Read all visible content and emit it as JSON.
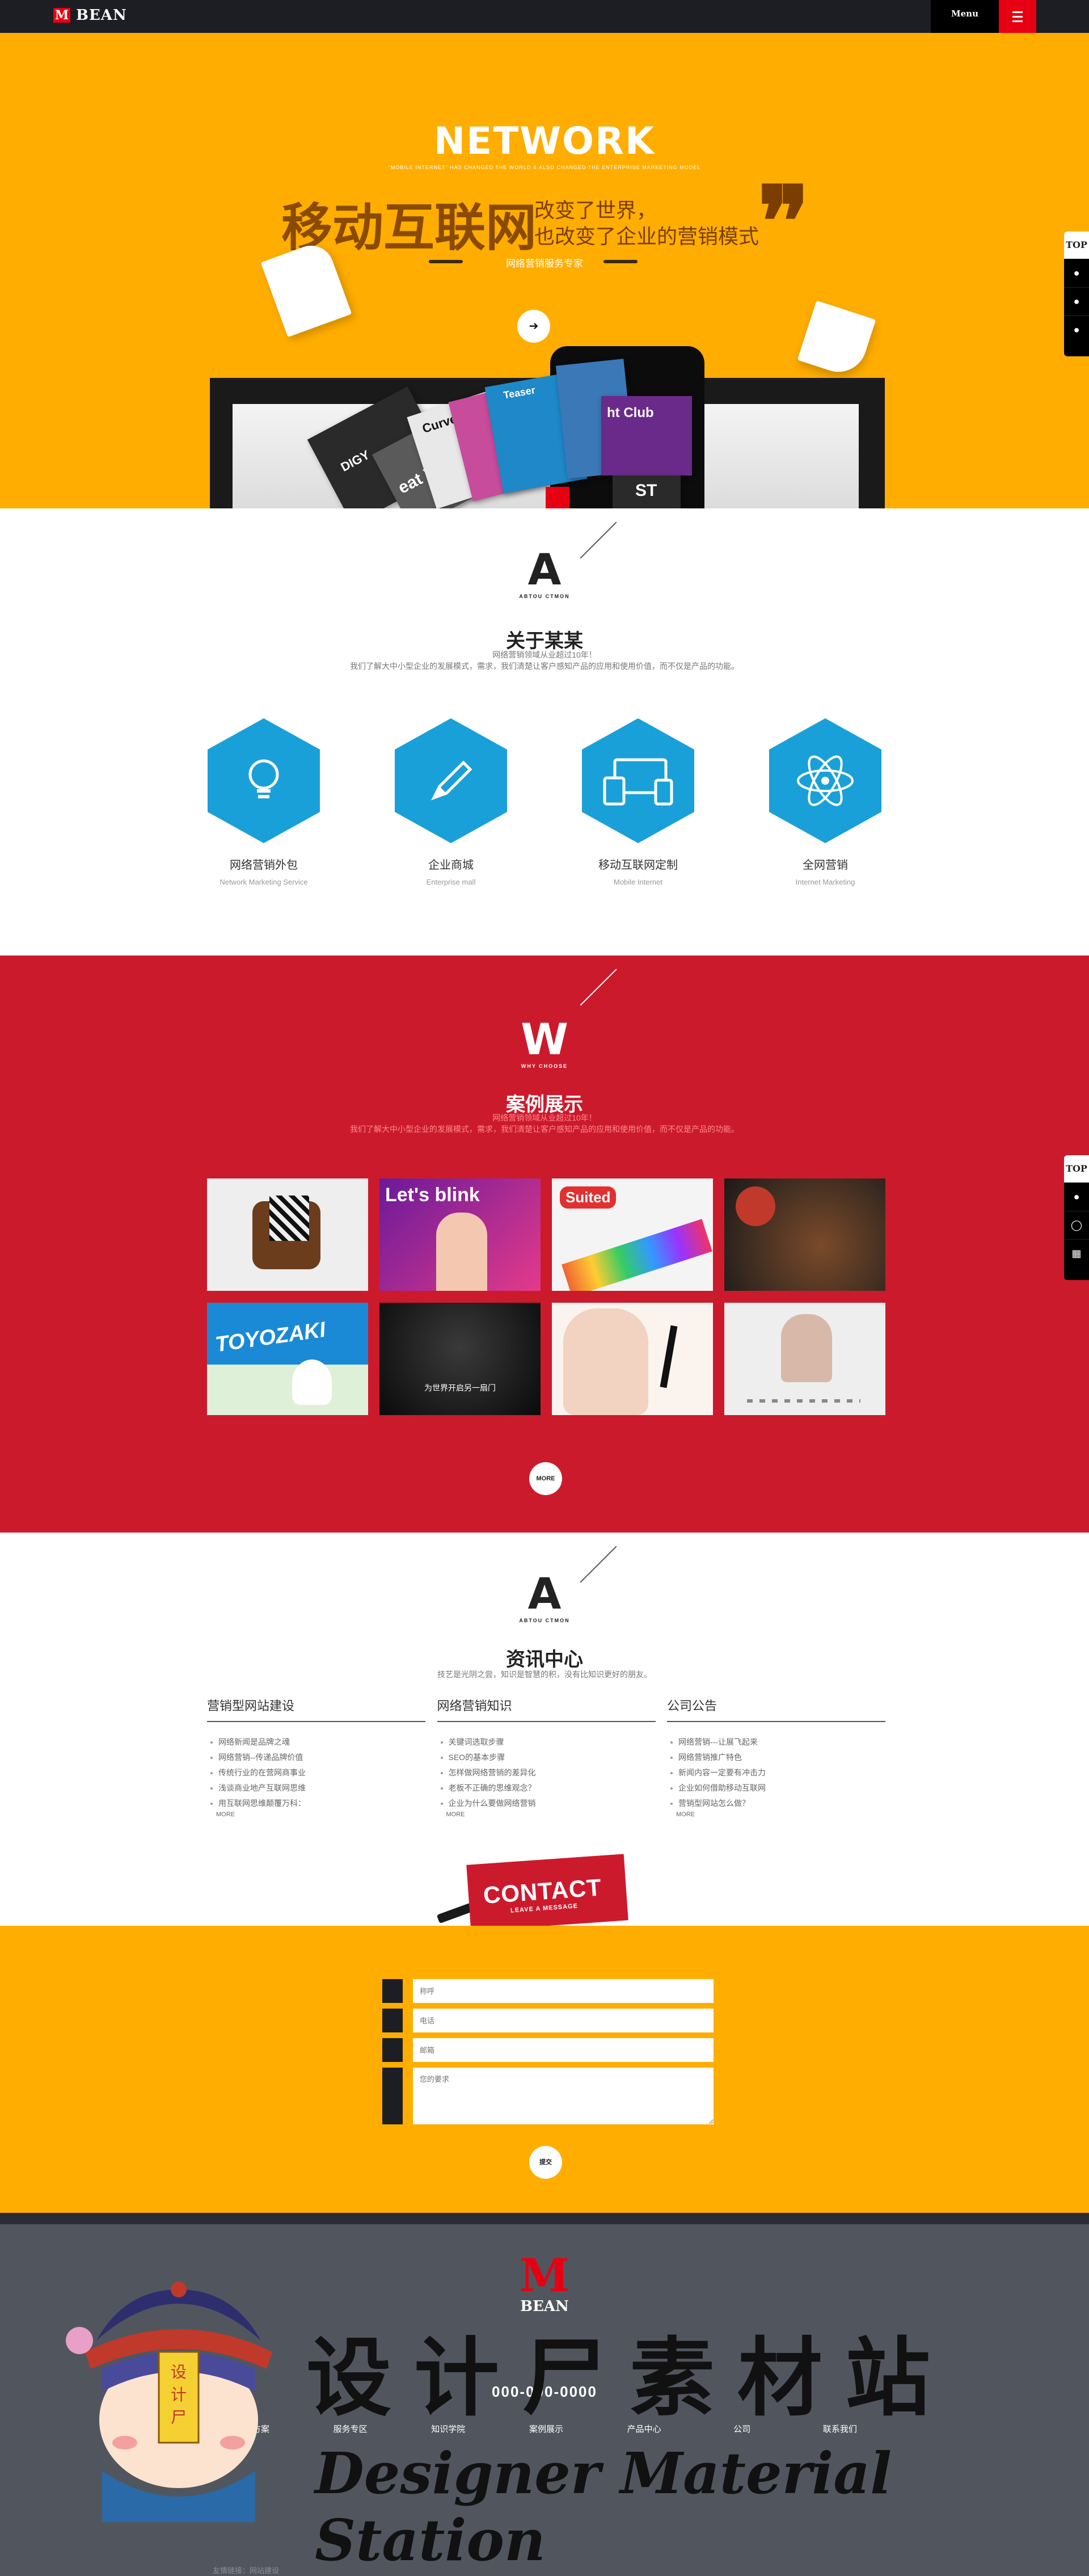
{
  "topbar": {
    "brand_mark": "M",
    "brand": "BEAN",
    "menu_label": "Menu"
  },
  "hero": {
    "title_en": "NETWORK",
    "subtitle_en": "\"MOBILE INTERNET\" HAS CHANGED THE WORLD & ALSO CHANGED THE ENTERPRISE MARKETING MODEL",
    "headline": "移动互联网",
    "line1": "改变了世界，",
    "line2": "也改变了企业的营销模式",
    "tag": "网络营销服务专家",
    "quote": "❞",
    "arrow": "➔",
    "card_labels": [
      "DIGY",
      "Curve",
      "Teaser",
      "ht Club",
      "ST",
      "eat Vision"
    ]
  },
  "side_widget": {
    "top": "TOP"
  },
  "about": {
    "mark_letter": "A",
    "mark_sub": "ABTOU CTMON",
    "title": "关于某某",
    "line1": "网络营销领域从业超过10年！",
    "line2": "我们了解大中小型企业的发展模式，需求，我们清楚让客户感知产品的应用和使用价值，而不仅是产品的功能。",
    "services": [
      {
        "name": "网络营销外包",
        "en": "Network Marketing Service",
        "icon": "lightbulb-icon"
      },
      {
        "name": "企业商城",
        "en": "Enterprise mall",
        "icon": "pencil-icon"
      },
      {
        "name": "移动互联网定制",
        "en": "Mobile Internet",
        "icon": "devices-icon"
      },
      {
        "name": "全网营销",
        "en": "Internet Marketing",
        "icon": "atom-icon"
      }
    ]
  },
  "cases": {
    "mark_letter": "W",
    "mark_sub": "WHY CHOOSE",
    "title": "案例展示",
    "line1": "网络营销领域从业超过10年！",
    "line2": "我们了解大中小型企业的发展模式，需求，我们清楚让客户感知产品的应用和使用价值，而不仅是产品的功能。",
    "tiles": [
      {
        "label": ""
      },
      {
        "label": "Let's blink"
      },
      {
        "label": "Suited"
      },
      {
        "label": ""
      },
      {
        "label": "TOYOZAKI"
      },
      {
        "label": "为世界开启另一扇门"
      },
      {
        "label": ""
      },
      {
        "label": ""
      }
    ],
    "more": "MORE"
  },
  "news": {
    "mark_letter": "A",
    "mark_sub": "ABTOU CTMON",
    "title": "资讯中心",
    "subtitle": "技艺是光阴之尝，知识是智慧的积，没有比知识更好的朋友。",
    "columns": [
      {
        "title": "营销型网站建设",
        "items": [
          "网络新闻是品牌之魂",
          "网络营销--传递品牌价值",
          "传统行业的在营网商事业",
          "浅谈商业地产互联网思维",
          "用互联网思维颠覆万科："
        ],
        "more": "MORE"
      },
      {
        "title": "网络营销知识",
        "items": [
          "关键词选取步骤",
          "SEO的基本步骤",
          "怎样做网络营销的差异化",
          "老板不正确的思维观念？",
          "企业为什么要做网络营销"
        ],
        "more": "MORE"
      },
      {
        "title": "公司公告",
        "items": [
          "网络营销---让展飞起来",
          "网络营销推广特色",
          "新闻内容一定要有冲击力",
          "企业如何借助移动互联网",
          "营销型网站怎么做？"
        ],
        "more": "MORE"
      }
    ],
    "contact_big": "CONTACT",
    "contact_small": "LEAVE A MESSAGE"
  },
  "form": {
    "name_placeholder": "称呼",
    "phone_placeholder": "电话",
    "email_placeholder": "邮箱",
    "message_placeholder": "您的要求",
    "submit": "提交"
  },
  "footer": {
    "logo_mark": "M",
    "logo_text": "BEAN",
    "phone": "000-000-0000",
    "nav": [
      "解决方案",
      "服务专区",
      "知识学院",
      "案例展示",
      "产品中心",
      "公司",
      "联系我们"
    ],
    "copyright": "友情链接：网站建设"
  },
  "watermark": {
    "cn": "设计尸素材站",
    "en": "Designer Material Station",
    "badge": "设计尸"
  },
  "colors": {
    "yellow": "#ffad00",
    "red": "#cc1a2d",
    "blue": "#1aa0d9",
    "dark": "#1c1e24"
  }
}
